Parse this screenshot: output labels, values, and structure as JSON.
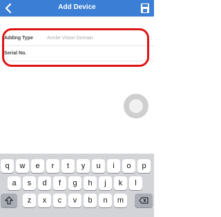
{
  "header": {
    "title": "Add Device",
    "back_icon": "chevron-left-icon",
    "save_icon": "floppy-disk-icon"
  },
  "form": {
    "adding_type": {
      "label": "Adding Type",
      "value": "Annke Vision Domain"
    },
    "serial_no": {
      "label": "Serial No.",
      "value": ""
    }
  },
  "keyboard": {
    "row1": [
      "q",
      "w",
      "e",
      "r",
      "t",
      "y",
      "u",
      "i",
      "o",
      "p"
    ],
    "row2": [
      "a",
      "s",
      "d",
      "f",
      "g",
      "h",
      "j",
      "k",
      "l"
    ],
    "row3": [
      "z",
      "x",
      "c",
      "v",
      "b",
      "n",
      "m"
    ],
    "shift_icon": "shift-arrow-icon",
    "backspace_icon": "backspace-icon"
  },
  "colors": {
    "header_bg": "#3a7fd5",
    "highlight": "#e01414",
    "keyboard_bg": "#d2d4d8"
  }
}
